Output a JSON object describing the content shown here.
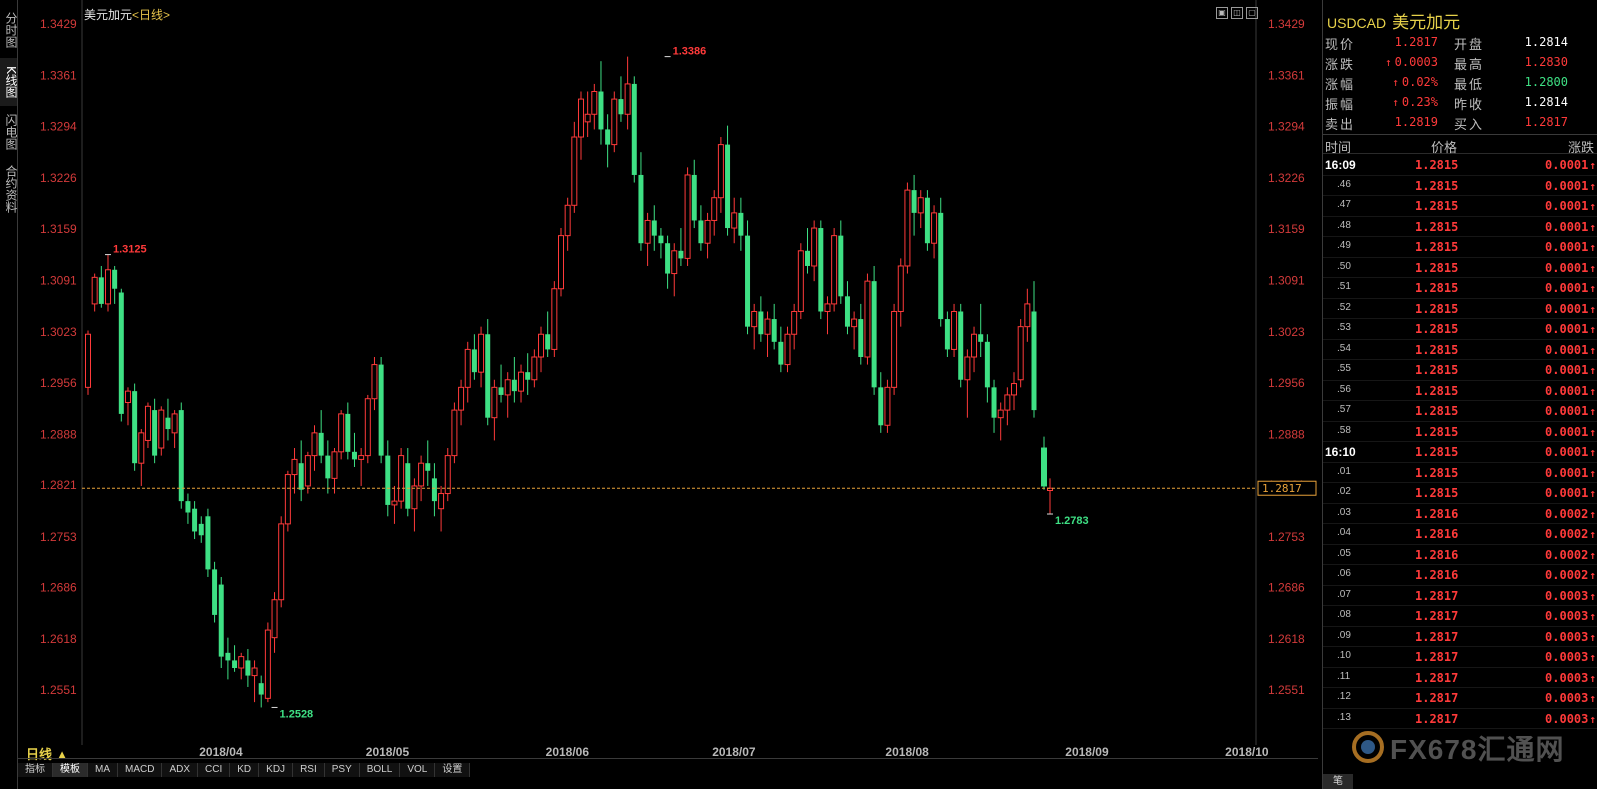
{
  "left_tabs": [
    {
      "label": "分时图"
    },
    {
      "label": "K线图"
    },
    {
      "label": "闪电图"
    },
    {
      "label": "合约资料"
    }
  ],
  "chart_header": {
    "name": "美元加元",
    "period": "<日线>"
  },
  "window_buttons": [
    "▣",
    "◫",
    "▢"
  ],
  "current_price_tag": "1.2817",
  "bottom": {
    "period_label": "日线 ▲",
    "indicator_tabs": [
      "指标",
      "模板",
      "MA",
      "MACD",
      "ADX",
      "CCI",
      "KD",
      "KDJ",
      "RSI",
      "PSY",
      "BOLL",
      "VOL",
      "设置"
    ]
  },
  "panel": {
    "symbol": "USDCAD",
    "name": "美元加元",
    "quote": [
      {
        "l1": "现价",
        "v1": "1.2817",
        "c1": "red",
        "l2": "开盘",
        "v2": "1.2814",
        "c2": "white"
      },
      {
        "l1": "涨跌",
        "v1": "0.0003",
        "c1": "red",
        "up1": true,
        "l2": "最高",
        "v2": "1.2830",
        "c2": "red"
      },
      {
        "l1": "涨幅",
        "v1": "0.02%",
        "c1": "red",
        "up1": true,
        "l2": "最低",
        "v2": "1.2800",
        "c2": "green"
      },
      {
        "l1": "振幅",
        "v1": "0.23%",
        "c1": "red",
        "up1": true,
        "l2": "昨收",
        "v2": "1.2814",
        "c2": "white"
      },
      {
        "l1": "卖出",
        "v1": "1.2819",
        "c1": "red",
        "l2": "买入",
        "v2": "1.2817",
        "c2": "red"
      }
    ],
    "table_head": {
      "time": "时间",
      "price": "价格",
      "change": "涨跌"
    },
    "ticks": [
      {
        "t": "16:09",
        "big": true,
        "p": "1.2815",
        "c": "0.0001"
      },
      {
        "t": ".46",
        "p": "1.2815",
        "c": "0.0001"
      },
      {
        "t": ".47",
        "p": "1.2815",
        "c": "0.0001"
      },
      {
        "t": ".48",
        "p": "1.2815",
        "c": "0.0001"
      },
      {
        "t": ".49",
        "p": "1.2815",
        "c": "0.0001"
      },
      {
        "t": ".50",
        "p": "1.2815",
        "c": "0.0001"
      },
      {
        "t": ".51",
        "p": "1.2815",
        "c": "0.0001"
      },
      {
        "t": ".52",
        "p": "1.2815",
        "c": "0.0001"
      },
      {
        "t": ".53",
        "p": "1.2815",
        "c": "0.0001"
      },
      {
        "t": ".54",
        "p": "1.2815",
        "c": "0.0001"
      },
      {
        "t": ".55",
        "p": "1.2815",
        "c": "0.0001"
      },
      {
        "t": ".56",
        "p": "1.2815",
        "c": "0.0001"
      },
      {
        "t": ".57",
        "p": "1.2815",
        "c": "0.0001"
      },
      {
        "t": ".58",
        "p": "1.2815",
        "c": "0.0001"
      },
      {
        "t": "16:10",
        "big": true,
        "p": "1.2815",
        "c": "0.0001"
      },
      {
        "t": ".01",
        "p": "1.2815",
        "c": "0.0001"
      },
      {
        "t": ".02",
        "p": "1.2815",
        "c": "0.0001"
      },
      {
        "t": ".03",
        "p": "1.2816",
        "c": "0.0002"
      },
      {
        "t": ".04",
        "p": "1.2816",
        "c": "0.0002"
      },
      {
        "t": ".05",
        "p": "1.2816",
        "c": "0.0002"
      },
      {
        "t": ".06",
        "p": "1.2816",
        "c": "0.0002"
      },
      {
        "t": ".07",
        "p": "1.2817",
        "c": "0.0003"
      },
      {
        "t": ".08",
        "p": "1.2817",
        "c": "0.0003"
      },
      {
        "t": ".09",
        "p": "1.2817",
        "c": "0.0003"
      },
      {
        "t": ".10",
        "p": "1.2817",
        "c": "0.0003"
      },
      {
        "t": ".11",
        "p": "1.2817",
        "c": "0.0003"
      },
      {
        "t": ".12",
        "p": "1.2817",
        "c": "0.0003"
      },
      {
        "t": ".13",
        "p": "1.2817",
        "c": "0.0003"
      }
    ],
    "bottom_tab": "笔"
  },
  "watermark": "FX678汇通网",
  "colors": {
    "up": "#ff3a3a",
    "down": "#3ee084",
    "priceLine": "#e8a23a",
    "axis": "#3a3a3a"
  },
  "chart_data": {
    "type": "candlestick",
    "title": "美元加元",
    "period": "日线",
    "ylim": [
      1.25,
      1.345
    ],
    "y_ticks": [
      "1.3429",
      "1.3361",
      "1.3294",
      "1.3226",
      "1.3159",
      "1.3091",
      "1.3023",
      "1.2956",
      "1.2888",
      "1.2821",
      "1.2753",
      "1.2686",
      "1.2618",
      "1.2551"
    ],
    "x_tick_labels": [
      "2018/04",
      "2018/05",
      "2018/06",
      "2018/07",
      "2018/08",
      "2018/09",
      "2018/10"
    ],
    "x_tick_index": [
      20,
      45,
      72,
      97,
      123,
      150,
      174
    ],
    "current_price": 1.2817,
    "annotations": [
      {
        "label": "1.3125",
        "index": 3,
        "value": 1.3125,
        "kind": "high"
      },
      {
        "label": "1.3386",
        "index": 87,
        "value": 1.3386,
        "kind": "high"
      },
      {
        "label": "1.2528",
        "index": 28,
        "value": 1.2528,
        "kind": "low"
      },
      {
        "label": "1.2783",
        "index": 177,
        "value": 1.2783,
        "kind": "low"
      }
    ],
    "ohlc": [
      [
        1.295,
        1.3025,
        1.294,
        1.302
      ],
      [
        1.306,
        1.31,
        1.305,
        1.3095
      ],
      [
        1.3095,
        1.311,
        1.3055,
        1.306
      ],
      [
        1.306,
        1.3125,
        1.305,
        1.3105
      ],
      [
        1.3105,
        1.311,
        1.306,
        1.308
      ],
      [
        1.3075,
        1.308,
        1.2905,
        1.2915
      ],
      [
        1.293,
        1.295,
        1.29,
        1.2945
      ],
      [
        1.2945,
        1.2955,
        1.284,
        1.285
      ],
      [
        1.285,
        1.2895,
        1.282,
        1.289
      ],
      [
        1.288,
        1.293,
        1.287,
        1.2925
      ],
      [
        1.292,
        1.2935,
        1.285,
        1.286
      ],
      [
        1.287,
        1.2925,
        1.286,
        1.292
      ],
      [
        1.291,
        1.2935,
        1.288,
        1.2895
      ],
      [
        1.289,
        1.292,
        1.287,
        1.2915
      ],
      [
        1.292,
        1.293,
        1.279,
        1.28
      ],
      [
        1.28,
        1.281,
        1.277,
        1.2785
      ],
      [
        1.279,
        1.28,
        1.275,
        1.276
      ],
      [
        1.277,
        1.278,
        1.2745,
        1.2755
      ],
      [
        1.278,
        1.279,
        1.27,
        1.271
      ],
      [
        1.271,
        1.272,
        1.264,
        1.265
      ],
      [
        1.269,
        1.27,
        1.258,
        1.2595
      ],
      [
        1.26,
        1.262,
        1.2565,
        1.259
      ],
      [
        1.259,
        1.261,
        1.2575,
        1.258
      ],
      [
        1.258,
        1.26,
        1.2565,
        1.2595
      ],
      [
        1.259,
        1.2605,
        1.2555,
        1.257
      ],
      [
        1.257,
        1.259,
        1.2535,
        1.258
      ],
      [
        1.256,
        1.257,
        1.2528,
        1.2545
      ],
      [
        1.254,
        1.264,
        1.2535,
        1.263
      ],
      [
        1.262,
        1.268,
        1.26,
        1.267
      ],
      [
        1.267,
        1.278,
        1.266,
        1.277
      ],
      [
        1.277,
        1.284,
        1.276,
        1.2835
      ],
      [
        1.2835,
        1.287,
        1.281,
        1.2855
      ],
      [
        1.285,
        1.288,
        1.28,
        1.2815
      ],
      [
        1.282,
        1.2865,
        1.281,
        1.286
      ],
      [
        1.286,
        1.29,
        1.284,
        1.289
      ],
      [
        1.289,
        1.292,
        1.285,
        1.286
      ],
      [
        1.286,
        1.288,
        1.281,
        1.283
      ],
      [
        1.283,
        1.287,
        1.281,
        1.2865
      ],
      [
        1.2865,
        1.292,
        1.2855,
        1.2915
      ],
      [
        1.2915,
        1.293,
        1.2855,
        1.2865
      ],
      [
        1.2865,
        1.289,
        1.2845,
        1.2855
      ],
      [
        1.2855,
        1.287,
        1.282,
        1.286
      ],
      [
        1.286,
        1.294,
        1.285,
        1.2935
      ],
      [
        1.2935,
        1.299,
        1.292,
        1.298
      ],
      [
        1.298,
        1.299,
        1.285,
        1.286
      ],
      [
        1.286,
        1.288,
        1.278,
        1.2795
      ],
      [
        1.2795,
        1.282,
        1.277,
        1.28
      ],
      [
        1.28,
        1.287,
        1.279,
        1.286
      ],
      [
        1.285,
        1.287,
        1.278,
        1.279
      ],
      [
        1.279,
        1.283,
        1.276,
        1.282
      ],
      [
        1.282,
        1.286,
        1.28,
        1.285
      ],
      [
        1.285,
        1.288,
        1.282,
        1.284
      ],
      [
        1.283,
        1.285,
        1.278,
        1.28
      ],
      [
        1.279,
        1.282,
        1.276,
        1.281
      ],
      [
        1.281,
        1.287,
        1.28,
        1.286
      ],
      [
        1.286,
        1.293,
        1.285,
        1.292
      ],
      [
        1.292,
        1.296,
        1.29,
        1.295
      ],
      [
        1.295,
        1.301,
        1.293,
        1.3
      ],
      [
        1.3,
        1.302,
        1.296,
        1.297
      ],
      [
        1.297,
        1.303,
        1.295,
        1.302
      ],
      [
        1.302,
        1.304,
        1.29,
        1.291
      ],
      [
        1.291,
        1.296,
        1.288,
        1.295
      ],
      [
        1.295,
        1.298,
        1.293,
        1.294
      ],
      [
        1.294,
        1.297,
        1.291,
        1.296
      ],
      [
        1.296,
        1.299,
        1.293,
        1.2945
      ],
      [
        1.2945,
        1.298,
        1.293,
        1.297
      ],
      [
        1.297,
        1.2995,
        1.294,
        1.296
      ],
      [
        1.296,
        1.3,
        1.295,
        1.299
      ],
      [
        1.299,
        1.303,
        1.297,
        1.302
      ],
      [
        1.302,
        1.305,
        1.299,
        1.3
      ],
      [
        1.3,
        1.309,
        1.299,
        1.308
      ],
      [
        1.308,
        1.316,
        1.307,
        1.315
      ],
      [
        1.315,
        1.32,
        1.313,
        1.319
      ],
      [
        1.319,
        1.33,
        1.318,
        1.328
      ],
      [
        1.328,
        1.334,
        1.325,
        1.333
      ],
      [
        1.33,
        1.334,
        1.328,
        1.331
      ],
      [
        1.331,
        1.335,
        1.329,
        1.334
      ],
      [
        1.334,
        1.338,
        1.327,
        1.329
      ],
      [
        1.329,
        1.331,
        1.324,
        1.327
      ],
      [
        1.327,
        1.334,
        1.326,
        1.333
      ],
      [
        1.333,
        1.336,
        1.33,
        1.331
      ],
      [
        1.331,
        1.3386,
        1.329,
        1.335
      ],
      [
        1.335,
        1.336,
        1.322,
        1.323
      ],
      [
        1.323,
        1.326,
        1.313,
        1.314
      ],
      [
        1.314,
        1.318,
        1.311,
        1.317
      ],
      [
        1.317,
        1.319,
        1.313,
        1.315
      ],
      [
        1.315,
        1.316,
        1.312,
        1.314
      ],
      [
        1.314,
        1.315,
        1.308,
        1.31
      ],
      [
        1.31,
        1.314,
        1.307,
        1.313
      ],
      [
        1.313,
        1.316,
        1.311,
        1.312
      ],
      [
        1.312,
        1.324,
        1.311,
        1.323
      ],
      [
        1.323,
        1.325,
        1.316,
        1.317
      ],
      [
        1.317,
        1.319,
        1.313,
        1.314
      ],
      [
        1.314,
        1.318,
        1.312,
        1.317
      ],
      [
        1.317,
        1.321,
        1.315,
        1.32
      ],
      [
        1.32,
        1.328,
        1.318,
        1.327
      ],
      [
        1.327,
        1.3295,
        1.315,
        1.316
      ],
      [
        1.316,
        1.32,
        1.314,
        1.318
      ],
      [
        1.318,
        1.32,
        1.313,
        1.315
      ],
      [
        1.315,
        1.317,
        1.302,
        1.303
      ],
      [
        1.303,
        1.306,
        1.3,
        1.305
      ],
      [
        1.305,
        1.307,
        1.301,
        1.302
      ],
      [
        1.302,
        1.305,
        1.299,
        1.304
      ],
      [
        1.304,
        1.306,
        1.3,
        1.301
      ],
      [
        1.301,
        1.303,
        1.297,
        1.298
      ],
      [
        1.298,
        1.303,
        1.297,
        1.302
      ],
      [
        1.302,
        1.306,
        1.3,
        1.305
      ],
      [
        1.305,
        1.314,
        1.304,
        1.313
      ],
      [
        1.313,
        1.316,
        1.31,
        1.311
      ],
      [
        1.311,
        1.317,
        1.309,
        1.316
      ],
      [
        1.316,
        1.317,
        1.304,
        1.305
      ],
      [
        1.305,
        1.307,
        1.302,
        1.306
      ],
      [
        1.306,
        1.316,
        1.305,
        1.315
      ],
      [
        1.315,
        1.317,
        1.306,
        1.307
      ],
      [
        1.307,
        1.309,
        1.302,
        1.303
      ],
      [
        1.303,
        1.305,
        1.3,
        1.304
      ],
      [
        1.304,
        1.306,
        1.298,
        1.299
      ],
      [
        1.299,
        1.31,
        1.298,
        1.309
      ],
      [
        1.309,
        1.311,
        1.294,
        1.295
      ],
      [
        1.295,
        1.297,
        1.289,
        1.29
      ],
      [
        1.29,
        1.296,
        1.289,
        1.295
      ],
      [
        1.295,
        1.306,
        1.294,
        1.305
      ],
      [
        1.305,
        1.312,
        1.303,
        1.311
      ],
      [
        1.311,
        1.322,
        1.31,
        1.321
      ],
      [
        1.321,
        1.323,
        1.315,
        1.318
      ],
      [
        1.318,
        1.321,
        1.316,
        1.32
      ],
      [
        1.32,
        1.321,
        1.313,
        1.314
      ],
      [
        1.314,
        1.319,
        1.312,
        1.318
      ],
      [
        1.318,
        1.32,
        1.303,
        1.304
      ],
      [
        1.304,
        1.305,
        1.299,
        1.3
      ],
      [
        1.3,
        1.306,
        1.299,
        1.305
      ],
      [
        1.305,
        1.306,
        1.295,
        1.296
      ],
      [
        1.296,
        1.3,
        1.291,
        1.299
      ],
      [
        1.299,
        1.303,
        1.297,
        1.302
      ],
      [
        1.302,
        1.306,
        1.299,
        1.301
      ],
      [
        1.301,
        1.302,
        1.293,
        1.295
      ],
      [
        1.295,
        1.296,
        1.289,
        1.291
      ],
      [
        1.291,
        1.293,
        1.288,
        1.292
      ],
      [
        1.292,
        1.295,
        1.29,
        1.294
      ],
      [
        1.294,
        1.297,
        1.292,
        1.2955
      ],
      [
        1.296,
        1.304,
        1.295,
        1.303
      ],
      [
        1.303,
        1.308,
        1.301,
        1.306
      ],
      [
        1.305,
        1.309,
        1.291,
        1.292
      ]
    ]
  }
}
